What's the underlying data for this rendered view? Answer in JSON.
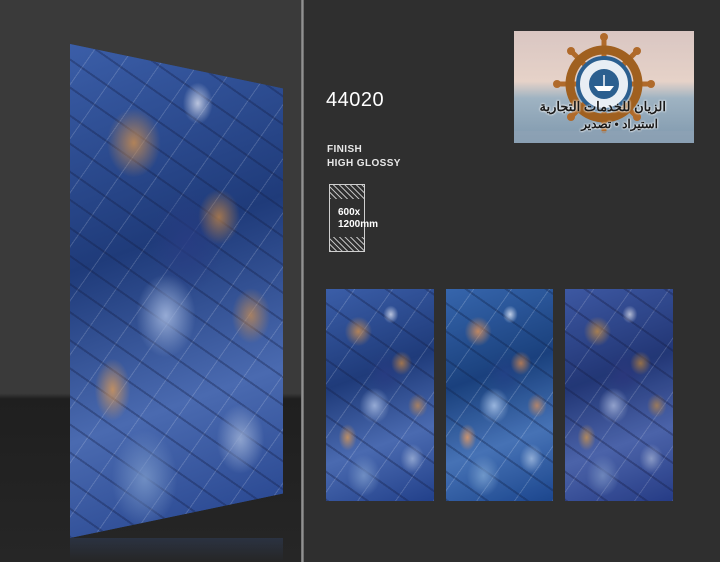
{
  "product": {
    "code": "44020",
    "finish_label": "FINISH",
    "finish_value": "HIGH GLOSSY",
    "size": "600x\n1200mm"
  },
  "logo": {
    "name_line": "الزيان للخدمات التجارية",
    "services_line": "استيراد  •  تصدير"
  },
  "colors": {
    "background": "#333333",
    "marble_blue": "#2a4a8a",
    "marble_gold": "#c88c50"
  },
  "tiles": [
    {
      "name": "tile-variation-1"
    },
    {
      "name": "tile-variation-2"
    },
    {
      "name": "tile-variation-3"
    }
  ]
}
